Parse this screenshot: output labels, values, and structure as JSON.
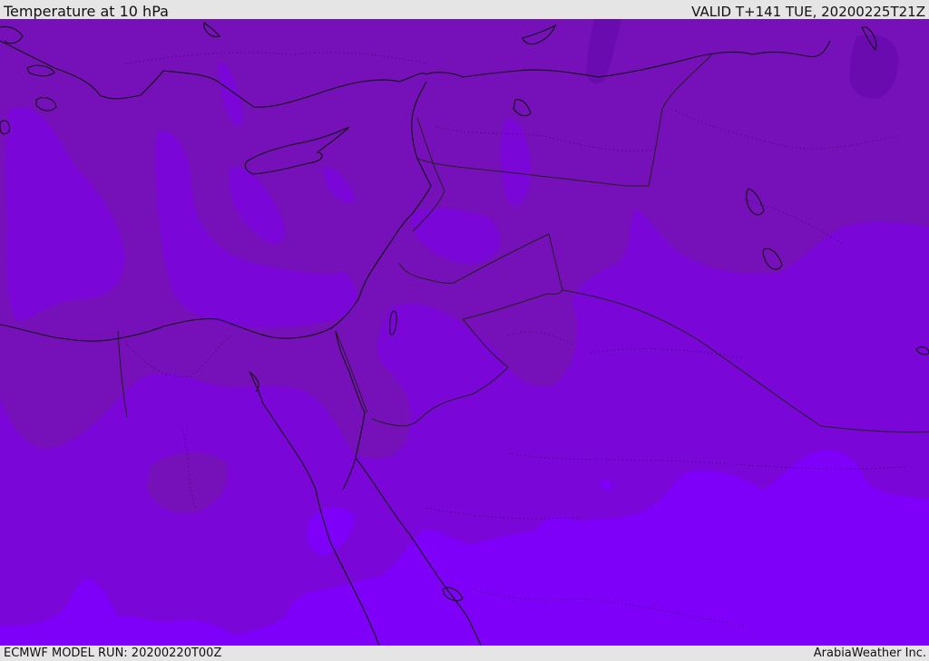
{
  "header": {
    "title": "Temperature at 10 hPa",
    "valid_time": "VALID T+141 TUE, 20200225T21Z"
  },
  "footer": {
    "model_run": "ECMWF MODEL RUN: 20200220T00Z",
    "credit": "ArabiaWeather Inc."
  },
  "map": {
    "variable": "temperature",
    "level": "10 hPa",
    "colors": {
      "darkest_purple": "#6a0bb0",
      "dark_purple": "#7610b8",
      "mid_purple": "#7b06d8",
      "light_violet": "#7f00f8",
      "coastline": "#111111",
      "border": "#222222"
    }
  }
}
